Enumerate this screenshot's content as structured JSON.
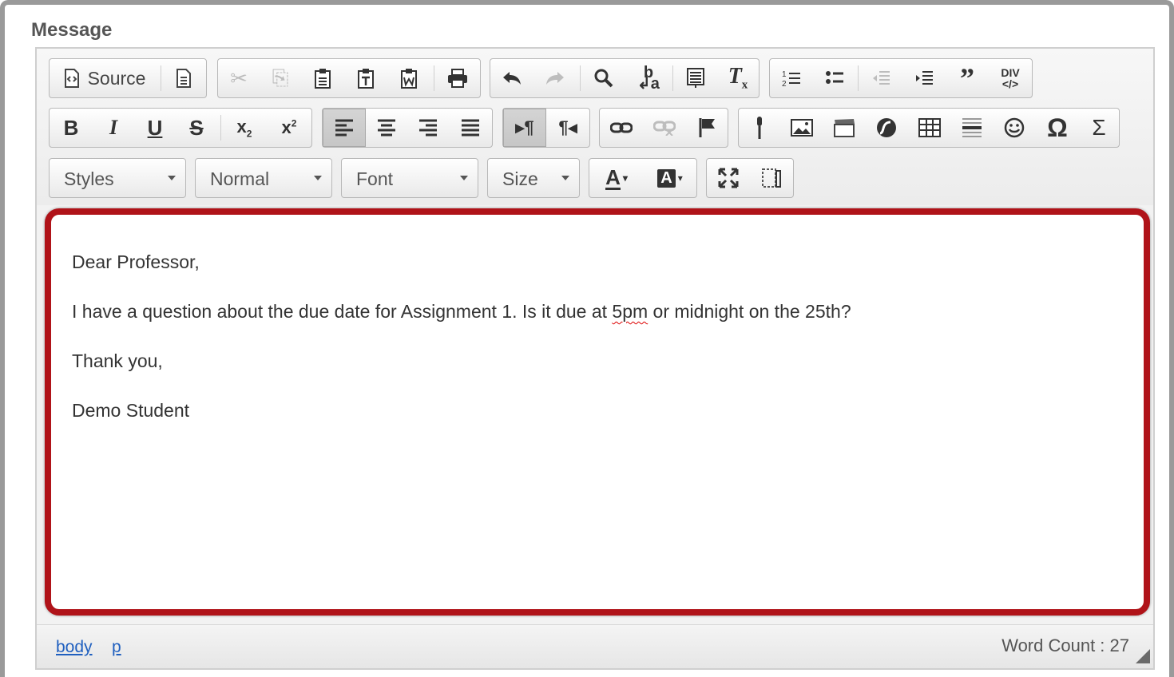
{
  "field_label": "Message",
  "toolbar": {
    "source_label": "Source",
    "styles_label": "Styles",
    "format_label": "Normal",
    "font_label": "Font",
    "size_label": "Size"
  },
  "content": {
    "paragraphs": [
      "Dear Professor,",
      "I have a question about the due date for Assignment 1. Is it due at ",
      "Thank you,",
      "Demo Student"
    ],
    "misspelled_word": "5pm",
    "paragraph_2_tail": " or midnight on the 25th?"
  },
  "bottom_bar": {
    "path_items": [
      "body",
      "p"
    ],
    "word_count": "Word Count : 27"
  },
  "colors": {
    "highlight_border": "#b01319",
    "link": "#1f5fbf"
  }
}
